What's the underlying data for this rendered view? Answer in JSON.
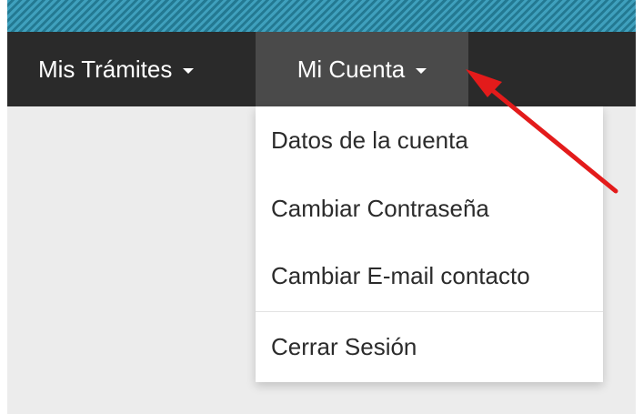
{
  "navbar": {
    "items": [
      {
        "label": "Mis Trámites"
      },
      {
        "label": "Mi Cuenta"
      }
    ]
  },
  "dropdown": {
    "items": [
      {
        "label": "Datos de la cuenta"
      },
      {
        "label": "Cambiar Contraseña"
      },
      {
        "label": "Cambiar E-mail contacto"
      },
      {
        "label": "Cerrar Sesión"
      }
    ]
  },
  "colors": {
    "navbar_bg": "#2a2a2a",
    "active_tab_bg": "#4a4a4a",
    "top_band": "#2f8aa6",
    "annotation_arrow": "#e31b1b",
    "page_bg": "#ececec"
  },
  "icons": {
    "caret": "chevron-down-icon",
    "annotation": "red-arrow-annotation"
  }
}
